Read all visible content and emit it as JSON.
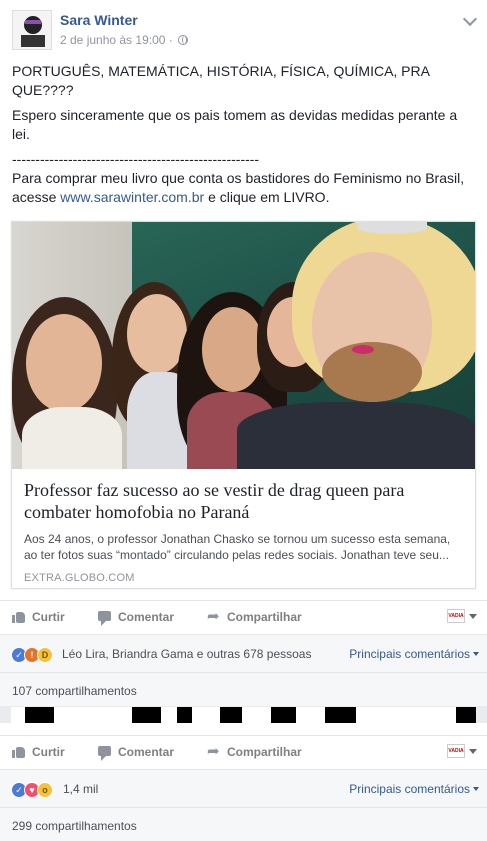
{
  "post1": {
    "author": "Sara Winter",
    "timestamp": "2 de junho às 19:00",
    "timestamp_sep": "·",
    "avatar_caption": "VADIA, NÃO!",
    "paragraphs": [
      "PORTUGUÊS, MATEMÁTICA, HISTÓRIA, FÍSICA, QUÍMICA, PRA QUE????",
      "Espero sinceramente que os pais tomem as devidas medidas perante a lei.",
      "-----------------------------------------------------"
    ],
    "promo_prefix": "Para comprar meu livro que conta os bastidores do Feminismo no Brasil, acesse ",
    "promo_link": "www.sarawinter.com.br",
    "promo_suffix": " e clique em LIVRO.",
    "link_card": {
      "title": "Professor faz sucesso ao se vestir de drag queen para combater homofobia no Paraná",
      "description": "Aos 24 anos, o professor Jonathan Chasko se tornou um sucesso esta semana, ao ter fotos suas “montado” circulando pelas redes sociais. Jonathan teve seu...",
      "domain": "EXTRA.GLOBO.COM"
    },
    "actions": {
      "like": "Curtir",
      "comment": "Comentar",
      "share": "Compartilhar",
      "page_icon_text": "VADIA"
    },
    "reactions": {
      "icons": [
        "like-reaction-icon",
        "angry-reaction-icon",
        "haha-reaction-icon"
      ],
      "text": "Léo Lira, Briandra Gama e outras 678 pessoas",
      "sort": "Principais comentários"
    },
    "shares": "107 compartilhamentos"
  },
  "post2": {
    "actions": {
      "like": "Curtir",
      "comment": "Comentar",
      "share": "Compartilhar",
      "page_icon_text": "VADIA"
    },
    "reactions": {
      "icons": [
        "like-reaction-icon",
        "love-reaction-icon",
        "wow-reaction-icon"
      ],
      "text": "1,4 mil",
      "sort": "Principais comentários"
    },
    "shares": "299 compartilhamentos"
  },
  "colors": {
    "link_blue": "#365899",
    "meta_gray": "#90949c",
    "action_gray": "#7f7f7f",
    "row_bg": "#f6f7f9",
    "page_bg": "#e9ebee"
  }
}
